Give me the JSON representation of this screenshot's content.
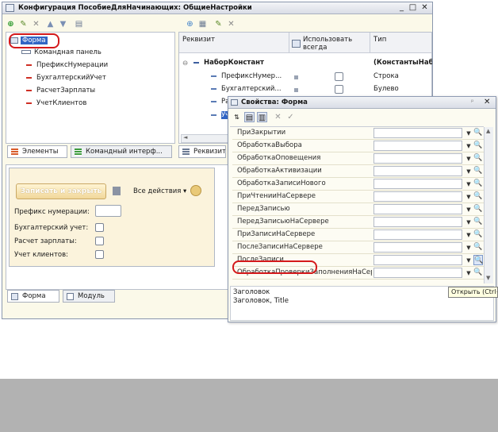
{
  "window": {
    "title": "Конфигурация ПособиеДляНачинающих: ОбщиеНастройки",
    "minimize": "_",
    "maximize": "□",
    "close": "✕"
  },
  "tree": {
    "root": "Форма",
    "items": [
      "Командная панель",
      "ПрефиксНумерации",
      "БухгалтерскийУчет",
      "РасчетЗарплаты",
      "УчетКлиентов"
    ]
  },
  "bottom_tabs_left": [
    "Элементы",
    "Командный интерф..."
  ],
  "grid": {
    "col_rekvizit": "Реквизит",
    "col_use": "Использовать всегда",
    "col_type": "Тип",
    "group_name": "НаборКонстант",
    "group_type": "(КонстантыНаб",
    "rows": [
      {
        "name": "ПрефиксНумер...",
        "type": "Строка"
      },
      {
        "name": "Бухгалтерский...",
        "type": "Булево"
      },
      {
        "name": "Ра",
        "type": ""
      },
      {
        "name": "Уч",
        "type": ""
      }
    ],
    "tab": "Реквизит"
  },
  "form_preview": {
    "save_button": "Записать и закрыть",
    "all_actions": "Все действия ▾",
    "fields": [
      {
        "label": "Префикс нумерации:",
        "kind": "text"
      },
      {
        "label": "Бухгалтерский учет:",
        "kind": "checkbox"
      },
      {
        "label": "Расчет зарплаты:",
        "kind": "checkbox"
      },
      {
        "label": "Учет клиентов:",
        "kind": "checkbox"
      }
    ]
  },
  "bottom_tabs_main": [
    "Форма",
    "Модуль"
  ],
  "props": {
    "title": "Свойства: Форма",
    "pin": "ᵖ",
    "close": "✕",
    "rows": [
      "ПриЗакрытии",
      "ОбработкаВыбора",
      "ОбработкаОповещения",
      "ОбработкаАктивизации",
      "ОбработкаЗаписиНового",
      "ПриЧтенииНаСервере",
      "ПередЗаписью",
      "ПередЗаписьюНаСервере",
      "ПриЗаписиНаСервере",
      "ПослеЗаписиНаСервере",
      "ПослеЗаписи",
      "ОбработкаПроверкиЗаполненияНаСер"
    ],
    "desc_title": "Заголовок",
    "desc_text": "Заголовок, Title",
    "tooltip": "Открыть (Ctrl+"
  },
  "colors": {
    "accent_red": "#d4191b",
    "panel_bg": "#fbf9e9",
    "gray_band": "#b2b2b2"
  }
}
